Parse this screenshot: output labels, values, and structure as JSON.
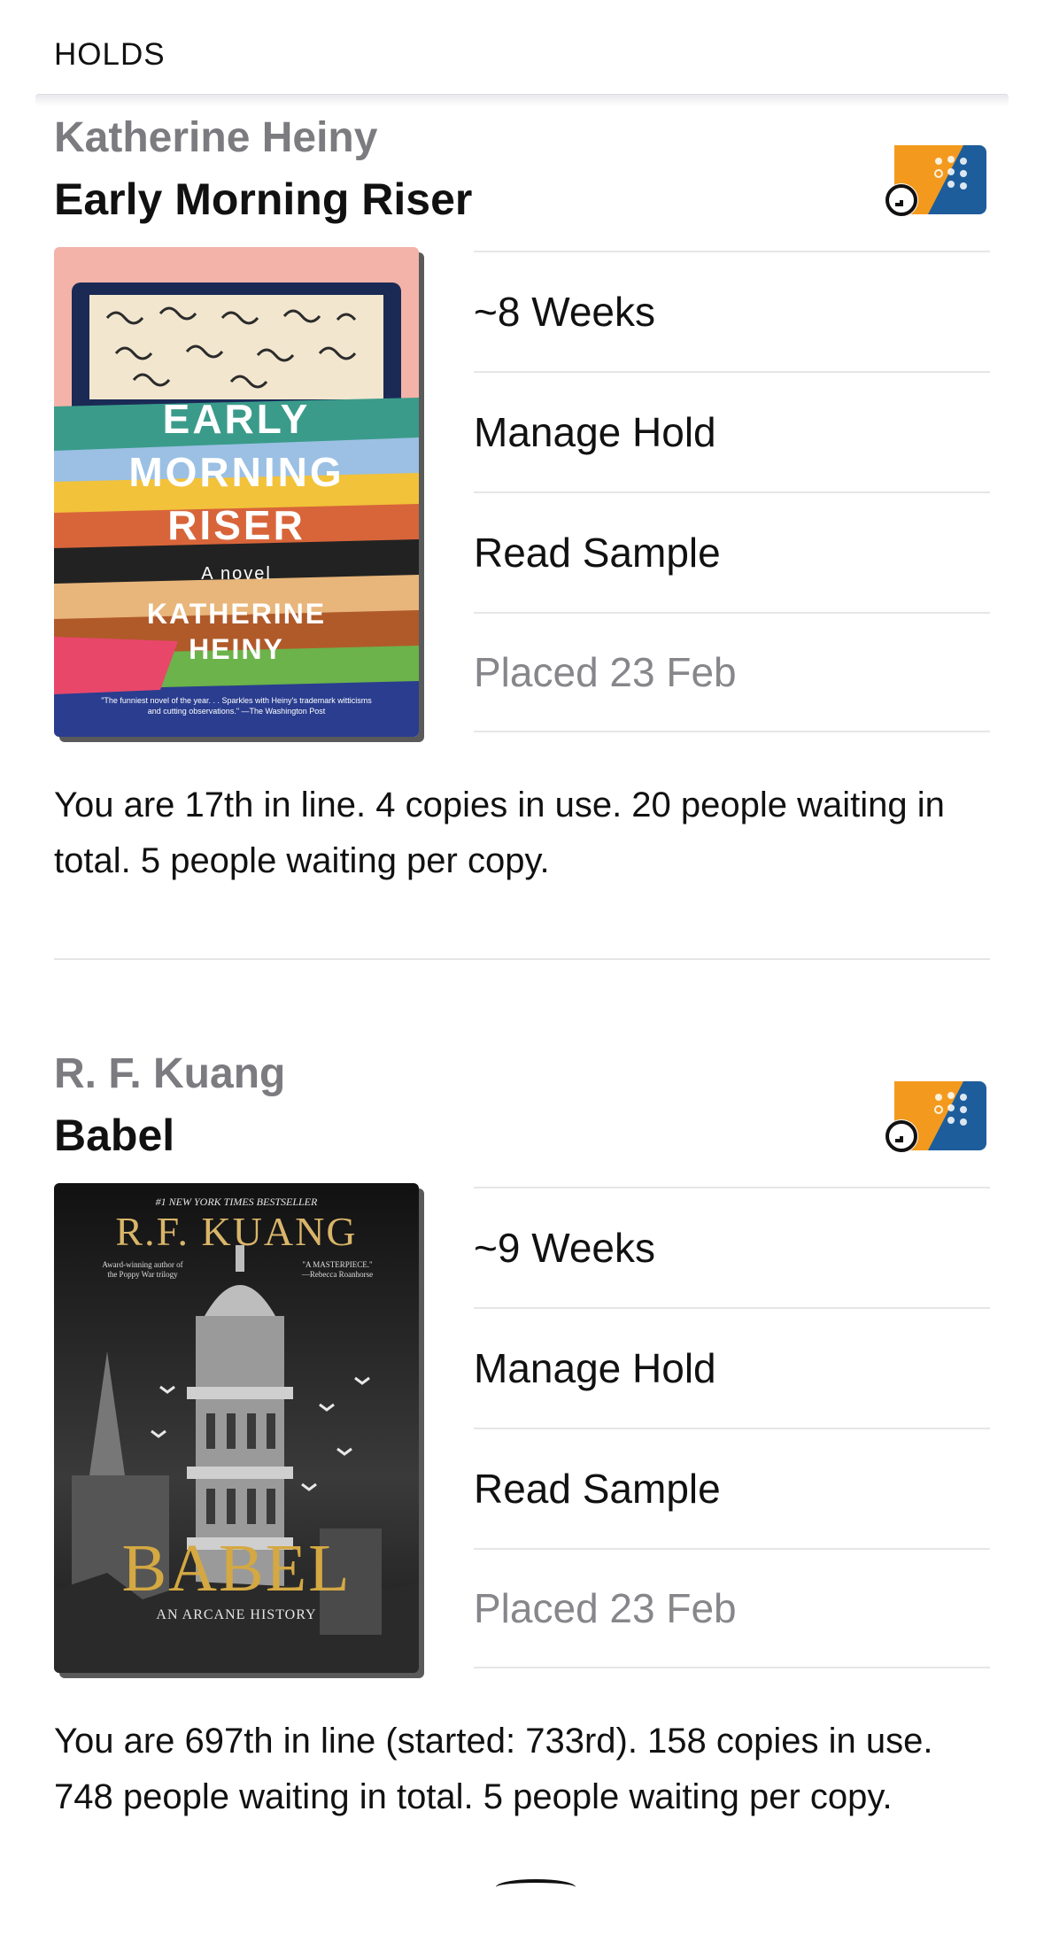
{
  "header": {
    "title": "HOLDS"
  },
  "holds": [
    {
      "author": "Katherine Heiny",
      "title": "Early Morning Riser",
      "cover": {
        "line1": "EARLY",
        "line2": "MORNING",
        "line3": "RISER",
        "subtitle": "A novel",
        "author_line1": "KATHERINE",
        "author_line2": "HEINY",
        "blurb1": "\"The funniest novel of the year. . . Sparkles with Heiny's trademark witticisms",
        "blurb2": "and cutting observations.\" —The Washington Post"
      },
      "wait_estimate": "~8 Weeks",
      "manage_label": "Manage Hold",
      "sample_label": "Read Sample",
      "placed": "Placed 23 Feb",
      "status_text": "You are 17th in line. 4 copies in use. 20 people waiting in total. 5 people waiting per copy."
    },
    {
      "author": "R. F. Kuang",
      "title": "Babel",
      "cover": {
        "bestseller": "#1 NEW YORK TIMES BESTSELLER",
        "author_name": "R.F. KUANG",
        "left_blurb1": "Award-winning author of",
        "left_blurb2": "the Poppy War trilogy",
        "right_blurb1": "\"A MASTERPIECE.\"",
        "right_blurb2": "—Rebecca Roanhorse",
        "book_title": "BABEL",
        "book_subtitle": "AN ARCANE HISTORY"
      },
      "wait_estimate": "~9 Weeks",
      "manage_label": "Manage Hold",
      "sample_label": "Read Sample",
      "placed": "Placed 23 Feb",
      "status_text": "You are 697th in line (started: 733rd). 158 copies in use. 748 people waiting in total. 5 people waiting per copy."
    }
  ],
  "colors": {
    "badge_orange": "#f39a1e",
    "badge_blue": "#1d5d9b",
    "muted_text": "#86868b",
    "divider": "#e6e6e9"
  },
  "icons": [
    "audiobook-hold-badge-icon",
    "clock-icon"
  ]
}
